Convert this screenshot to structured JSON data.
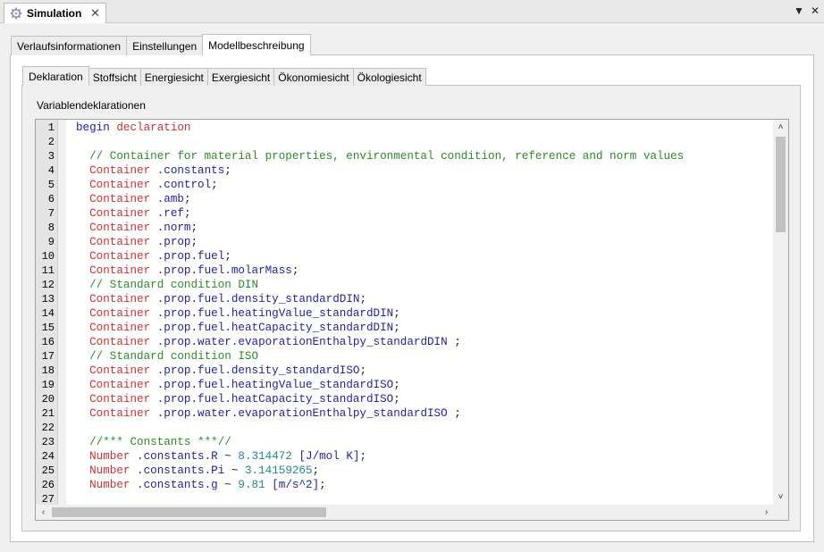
{
  "view_tab": {
    "title": "Simulation",
    "close": "✕"
  },
  "view_controls": {
    "menu": "▼",
    "close": "✕"
  },
  "outer_tabs": [
    {
      "label": "Verlaufsinformationen"
    },
    {
      "label": "Einstellungen"
    },
    {
      "label": "Modellbeschreibung"
    }
  ],
  "inner_tabs": [
    {
      "label": "Deklaration"
    },
    {
      "label": "Stoffsicht"
    },
    {
      "label": "Energiesicht"
    },
    {
      "label": "Exergiesicht"
    },
    {
      "label": "Ökonomiesicht"
    },
    {
      "label": "Ökologiesicht"
    }
  ],
  "section_label": "Variablendeklarationen",
  "colors": {
    "keyword": "#1c1ca8",
    "type": "#c83232",
    "identifier": "#2222a0",
    "comment": "#2a8a2a",
    "number": "#22888a"
  },
  "code_lines": [
    {
      "n": "1",
      "tokens": [
        {
          "t": "begin ",
          "c": "kw"
        },
        {
          "t": "declaration",
          "c": "ty"
        }
      ]
    },
    {
      "n": "2",
      "tokens": []
    },
    {
      "n": "3",
      "tokens": [
        {
          "t": "  // Container for material properties, environmental condition, reference and norm values",
          "c": "cm"
        }
      ]
    },
    {
      "n": "4",
      "tokens": [
        {
          "t": "  Container ",
          "c": "ty"
        },
        {
          "t": ".constants",
          "c": "id"
        },
        {
          "t": ";",
          "c": "pl"
        }
      ]
    },
    {
      "n": "5",
      "tokens": [
        {
          "t": "  Container ",
          "c": "ty"
        },
        {
          "t": ".control",
          "c": "id"
        },
        {
          "t": ";",
          "c": "pl"
        }
      ]
    },
    {
      "n": "6",
      "tokens": [
        {
          "t": "  Container ",
          "c": "ty"
        },
        {
          "t": ".amb",
          "c": "id"
        },
        {
          "t": ";",
          "c": "pl"
        }
      ]
    },
    {
      "n": "7",
      "tokens": [
        {
          "t": "  Container ",
          "c": "ty"
        },
        {
          "t": ".ref",
          "c": "id"
        },
        {
          "t": ";",
          "c": "pl"
        }
      ]
    },
    {
      "n": "8",
      "tokens": [
        {
          "t": "  Container ",
          "c": "ty"
        },
        {
          "t": ".norm",
          "c": "id"
        },
        {
          "t": ";",
          "c": "pl"
        }
      ]
    },
    {
      "n": "9",
      "tokens": [
        {
          "t": "  Container ",
          "c": "ty"
        },
        {
          "t": ".prop",
          "c": "id"
        },
        {
          "t": ";",
          "c": "pl"
        }
      ]
    },
    {
      "n": "10",
      "tokens": [
        {
          "t": "  Container ",
          "c": "ty"
        },
        {
          "t": ".prop.fuel",
          "c": "id"
        },
        {
          "t": ";",
          "c": "pl"
        }
      ]
    },
    {
      "n": "11",
      "tokens": [
        {
          "t": "  Container ",
          "c": "ty"
        },
        {
          "t": ".prop.fuel.molarMass",
          "c": "id"
        },
        {
          "t": ";",
          "c": "pl"
        }
      ]
    },
    {
      "n": "12",
      "tokens": [
        {
          "t": "  // Standard condition DIN",
          "c": "cm"
        }
      ]
    },
    {
      "n": "13",
      "tokens": [
        {
          "t": "  Container ",
          "c": "ty"
        },
        {
          "t": ".prop.fuel.density_standardDIN",
          "c": "id"
        },
        {
          "t": ";",
          "c": "pl"
        }
      ]
    },
    {
      "n": "14",
      "tokens": [
        {
          "t": "  Container ",
          "c": "ty"
        },
        {
          "t": ".prop.fuel.heatingValue_standardDIN",
          "c": "id"
        },
        {
          "t": ";",
          "c": "pl"
        }
      ]
    },
    {
      "n": "15",
      "tokens": [
        {
          "t": "  Container ",
          "c": "ty"
        },
        {
          "t": ".prop.fuel.heatCapacity_standardDIN",
          "c": "id"
        },
        {
          "t": ";",
          "c": "pl"
        }
      ]
    },
    {
      "n": "16",
      "tokens": [
        {
          "t": "  Container ",
          "c": "ty"
        },
        {
          "t": ".prop.water.evaporationEnthalpy_standardDIN",
          "c": "id"
        },
        {
          "t": " ;",
          "c": "pl"
        }
      ]
    },
    {
      "n": "17",
      "tokens": [
        {
          "t": "  // Standard condition ISO",
          "c": "cm"
        }
      ]
    },
    {
      "n": "18",
      "tokens": [
        {
          "t": "  Container ",
          "c": "ty"
        },
        {
          "t": ".prop.fuel.density_standardISO",
          "c": "id"
        },
        {
          "t": ";",
          "c": "pl"
        }
      ]
    },
    {
      "n": "19",
      "tokens": [
        {
          "t": "  Container ",
          "c": "ty"
        },
        {
          "t": ".prop.fuel.heatingValue_standardISO",
          "c": "id"
        },
        {
          "t": ";",
          "c": "pl"
        }
      ]
    },
    {
      "n": "20",
      "tokens": [
        {
          "t": "  Container ",
          "c": "ty"
        },
        {
          "t": ".prop.fuel.heatCapacity_standardISO",
          "c": "id"
        },
        {
          "t": ";",
          "c": "pl"
        }
      ]
    },
    {
      "n": "21",
      "tokens": [
        {
          "t": "  Container ",
          "c": "ty"
        },
        {
          "t": ".prop.water.evaporationEnthalpy_standardISO",
          "c": "id"
        },
        {
          "t": " ;",
          "c": "pl"
        }
      ]
    },
    {
      "n": "22",
      "tokens": []
    },
    {
      "n": "23",
      "tokens": [
        {
          "t": "  //*** Constants ***//",
          "c": "cm"
        }
      ]
    },
    {
      "n": "24",
      "tokens": [
        {
          "t": "  Number ",
          "c": "ty"
        },
        {
          "t": ".constants.R",
          "c": "id"
        },
        {
          "t": " ~ ",
          "c": "pl"
        },
        {
          "t": "8.314472",
          "c": "num"
        },
        {
          "t": " [J/mol K]",
          "c": "id"
        },
        {
          "t": ";",
          "c": "pl"
        }
      ]
    },
    {
      "n": "25",
      "tokens": [
        {
          "t": "  Number ",
          "c": "ty"
        },
        {
          "t": ".constants.Pi",
          "c": "id"
        },
        {
          "t": " ~ ",
          "c": "pl"
        },
        {
          "t": "3.14159265",
          "c": "num"
        },
        {
          "t": ";",
          "c": "pl"
        }
      ]
    },
    {
      "n": "26",
      "tokens": [
        {
          "t": "  Number ",
          "c": "ty"
        },
        {
          "t": ".constants.g",
          "c": "id"
        },
        {
          "t": " ~ ",
          "c": "pl"
        },
        {
          "t": "9.81",
          "c": "num"
        },
        {
          "t": " [m/s^2]",
          "c": "id"
        },
        {
          "t": ";",
          "c": "pl"
        }
      ]
    },
    {
      "n": "27",
      "tokens": []
    }
  ],
  "scrollbars": {
    "up": "˄",
    "down": "˅",
    "left": "‹",
    "right": "›"
  }
}
